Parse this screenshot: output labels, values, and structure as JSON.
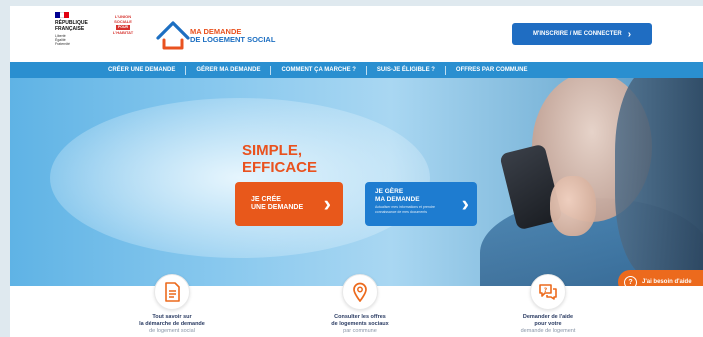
{
  "header": {
    "republique": [
      "RÉPUBLIQUE",
      "FRANÇAISE"
    ],
    "motto": [
      "Liberté",
      "Égalité",
      "Fraternité"
    ],
    "partner_logo": {
      "lines": [
        "L'UNION",
        "SOCIALE"
      ],
      "pour": "POUR",
      "last": "L'HABITAT"
    },
    "brand": {
      "line1": "MA DEMANDE",
      "line2": "DE LOGEMENT SOCIAL"
    },
    "cta_label": "M'INSCRIRE / ME CONNECTER",
    "cta_icon": "chevron-right-icon"
  },
  "nav": {
    "items": [
      {
        "label": "CRÉER UNE DEMANDE"
      },
      {
        "label": "GÉRER MA DEMANDE"
      },
      {
        "label": "COMMENT ÇA MARCHE ?"
      },
      {
        "label": "SUIS-JE ÉLIGIBLE ?"
      },
      {
        "label": "OFFRES PAR COMMUNE"
      }
    ]
  },
  "hero": {
    "title_line1": "SIMPLE,",
    "title_line2": "EFFICACE",
    "create_button": {
      "line1": "JE CRÉE",
      "line2": "UNE DEMANDE"
    },
    "manage_button": {
      "line1": "JE GÈRE",
      "line2": "MA DEMANDE",
      "sub": "Actualiser mes informations et prendre connaissance de mes documents"
    }
  },
  "help": {
    "label": "J'ai besoin d'aide"
  },
  "features": [
    {
      "icon": "document-icon",
      "line1": "Tout savoir sur",
      "line2": "la démarche de demande",
      "line3": "de logement social"
    },
    {
      "icon": "map-pin-icon",
      "line1": "Consulter les offres",
      "line2": "de logements sociaux",
      "line3": "par commune"
    },
    {
      "icon": "chat-help-icon",
      "line1": "Demander de l'aide",
      "line2": "pour votre",
      "line3": "demande de logement"
    }
  ],
  "colors": {
    "orange": "#e8581b",
    "blue": "#1f6dc2",
    "nav_blue": "#2a8fd0",
    "marianne_blue": "#000091",
    "marianne_red": "#e1000f"
  }
}
